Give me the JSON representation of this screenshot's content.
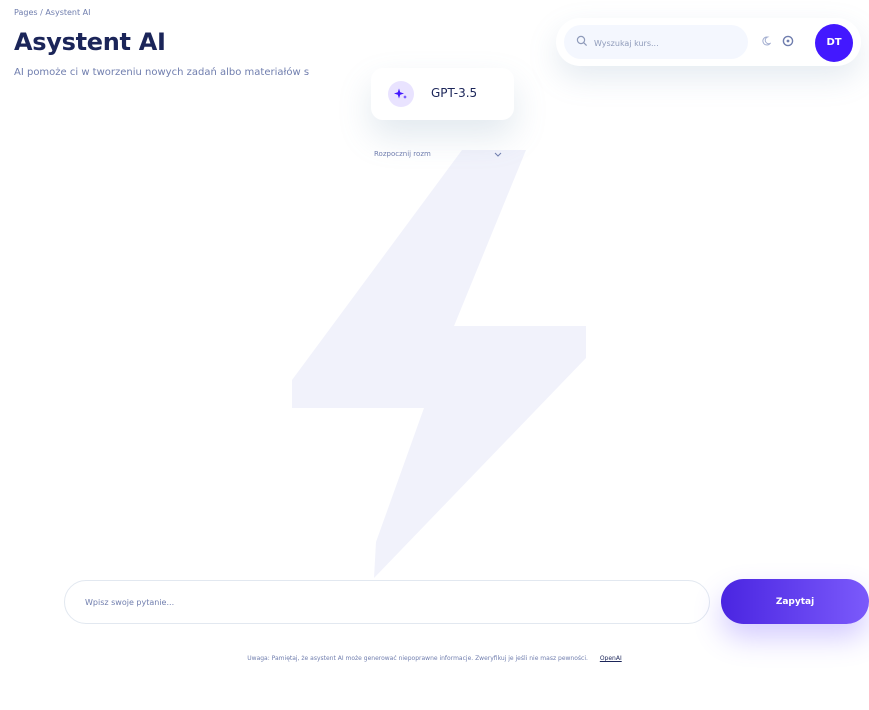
{
  "breadcrumb": "Pages / Asystent AI",
  "page_title": "Asystent AI",
  "subtitle": "AI pomoże ci w tworzeniu nowych zadań albo materiałów s",
  "search": {
    "placeholder": "Wyszukaj kurs..."
  },
  "user": {
    "initials": "DT"
  },
  "model": {
    "name": "GPT-3.5"
  },
  "dropdown": {
    "label": "Rozpocznij rozm"
  },
  "question": {
    "placeholder": "Wpisz swoje pytanie..."
  },
  "ask_button": {
    "label": "Zapytaj"
  },
  "footer": {
    "note": "Uwaga: Pamiętaj, że asystent AI może generować niepoprawne informacje. Zweryfikuj je jeśli nie masz pewności.",
    "link": "OpenAI"
  },
  "colors": {
    "accent": "#4318ff",
    "title": "#1b2559",
    "muted": "#707eae",
    "bolt": "#eef0fb"
  },
  "icons": [
    "search-icon",
    "moon-icon",
    "info-icon",
    "sparkle-icon",
    "chevron-down-icon",
    "lightning-bolt-icon"
  ]
}
